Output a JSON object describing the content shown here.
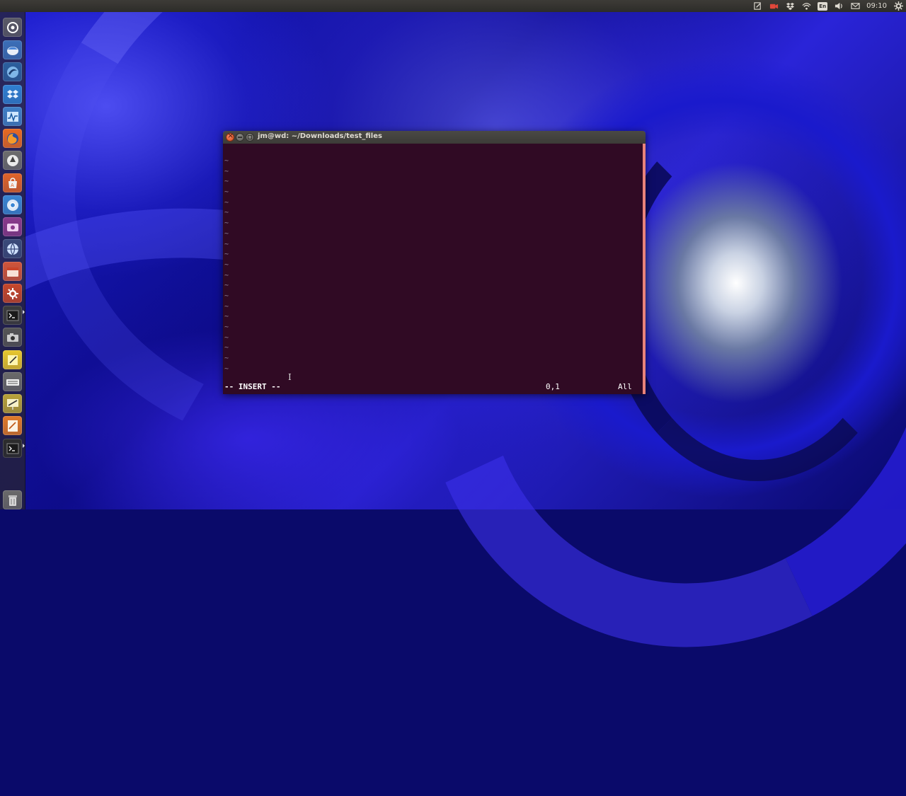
{
  "top_panel": {
    "language": "En",
    "clock": "09:10",
    "indicators": [
      "notes-icon",
      "camera-icon",
      "dropbox-icon",
      "wifi-icon",
      "keyboard-language-icon",
      "volume-icon",
      "mail-icon",
      "clock",
      "session-gear-icon"
    ]
  },
  "launcher": {
    "items": [
      {
        "name": "dash-home",
        "icon": "ubuntu-logo-icon",
        "color": "#5a5a66"
      },
      {
        "name": "thunderbird",
        "icon": "thunderbird-icon",
        "color": "#3b6fb8"
      },
      {
        "name": "browser-swirl",
        "icon": "swirl-icon",
        "color": "#2b5f9e"
      },
      {
        "name": "dropbox",
        "icon": "dropbox-icon",
        "color": "#2f7fd1"
      },
      {
        "name": "system-monitor",
        "icon": "system-monitor-icon",
        "color": "#3f7fc6"
      },
      {
        "name": "firefox",
        "icon": "firefox-icon",
        "color": "#e86a22"
      },
      {
        "name": "software-updater",
        "icon": "updater-icon",
        "color": "#6d6d6d"
      },
      {
        "name": "software-center",
        "icon": "software-center-icon",
        "color": "#e0642a"
      },
      {
        "name": "chromium",
        "icon": "chromium-icon",
        "color": "#3a86d4"
      },
      {
        "name": "media-player",
        "icon": "media-player-icon",
        "color": "#8a3a8c"
      },
      {
        "name": "web-browser-globe",
        "icon": "globe-icon",
        "color": "#3a4a7a"
      },
      {
        "name": "file-manager",
        "icon": "file-manager-icon",
        "color": "#d0553a"
      },
      {
        "name": "system-settings",
        "icon": "settings-icon",
        "color": "#c6472b"
      },
      {
        "name": "terminal",
        "icon": "terminal-icon",
        "color": "#3c3c3c"
      },
      {
        "name": "camera-app",
        "icon": "camera-icon",
        "color": "#555555"
      },
      {
        "name": "notes",
        "icon": "notes-icon",
        "color": "#e8c72e"
      },
      {
        "name": "keyboard",
        "icon": "keyboard-icon",
        "color": "#6a6a6a"
      },
      {
        "name": "presentation",
        "icon": "presentation-icon",
        "color": "#b8a23a"
      },
      {
        "name": "text-editor",
        "icon": "text-editor-icon",
        "color": "#e07a2a"
      },
      {
        "name": "terminal-2",
        "icon": "terminal-icon",
        "color": "#2c2c2c"
      },
      {
        "name": "trash",
        "icon": "trash-icon",
        "color": "#6a6a6a"
      }
    ]
  },
  "window": {
    "title": "jm@wd: ~/Downloads/test_files"
  },
  "vim": {
    "tildes": [
      "~",
      "~",
      "~",
      "~",
      "~",
      "~",
      "~",
      "~",
      "~",
      "~",
      "~",
      "~",
      "~",
      "~",
      "~",
      "~",
      "~",
      "~",
      "~",
      "~",
      "~"
    ],
    "mode": "-- INSERT --",
    "position": "0,1",
    "scroll": "All"
  }
}
